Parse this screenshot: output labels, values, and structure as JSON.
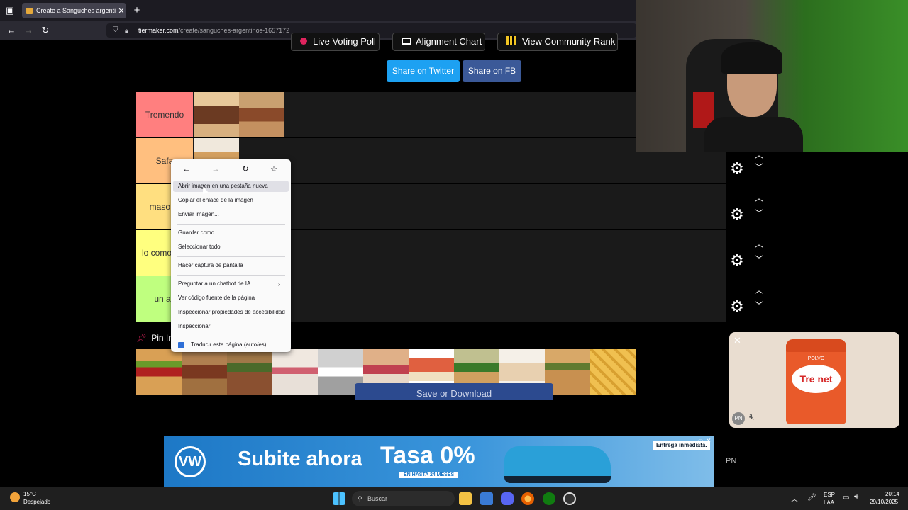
{
  "browser": {
    "tab_title": "Create a Sanguches argentinos",
    "tab_close": "✕",
    "new_tab": "+",
    "url_domain": "tiermaker.com",
    "url_path": "/create/sanguches-argentinos-1657172"
  },
  "page": {
    "top_buttons": [
      "Live Voting Poll",
      "Alignment Chart",
      "View Community Rank"
    ],
    "share_twitter": "Share on Twitter",
    "share_fb": "Share on FB",
    "tiers": [
      {
        "label": "Tremendo",
        "color": "#ff7f7f"
      },
      {
        "label": "Safa",
        "color": "#ffbf7f"
      },
      {
        "label": "maso m",
        "color": "#ffdf80"
      },
      {
        "label": "lo como asc",
        "color": "#ffff7f"
      },
      {
        "label": "un as",
        "color": "#bfff7f"
      }
    ],
    "pin_label": "Pin Im",
    "save_button": "Save or Download"
  },
  "context_menu": {
    "items": [
      "Abrir imagen en una pestaña nueva",
      "Copiar el enlace de la imagen",
      "Enviar imagen...",
      "Guardar como...",
      "Seleccionar todo",
      "Hacer captura de pantalla",
      "Preguntar a un chatbot de IA",
      "Ver código fuente de la página",
      "Inspeccionar propiedades de accesibilidad",
      "Inspeccionar",
      "Traducir esta página (auto/es)"
    ]
  },
  "ad_popup": {
    "brand": "Tre net",
    "tag": "POLVO",
    "pn": "PN"
  },
  "banner": {
    "headline": "Subite ahora",
    "rate": "Tasa 0%",
    "rate_sub": "EN HASTA 24 MESES",
    "delivery": "Entrega inmediata.",
    "pn": "PN"
  },
  "taskbar": {
    "temp": "15°C",
    "weather": "Despejado",
    "search": "Buscar",
    "lang_top": "ESP",
    "lang_bottom": "LAA",
    "time": "20:14",
    "date": "29/10/2025"
  }
}
